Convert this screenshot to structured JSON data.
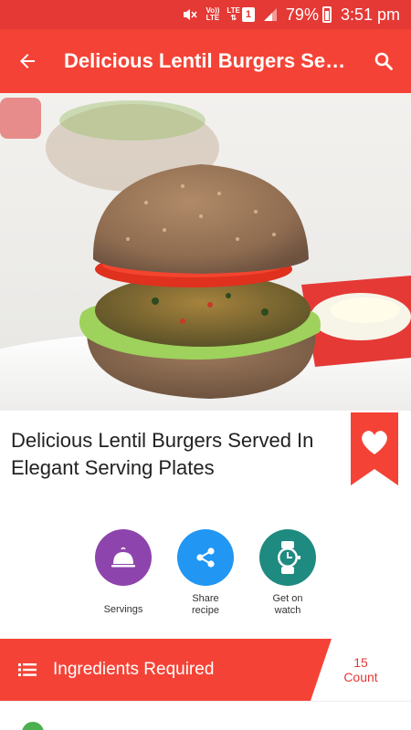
{
  "status_bar": {
    "network_label_top": "Vo))",
    "network_label_bottom": "LTE",
    "lte_label": "LTE",
    "sim_slot": "1",
    "battery": "79%",
    "time": "3:51 pm"
  },
  "app_bar": {
    "title": "Delicious Lentil Burgers Served In Elegant Serving Plates"
  },
  "recipe": {
    "title": "Delicious Lentil Burgers Served In Elegant Serving Plates"
  },
  "actions": [
    {
      "label": "Servings",
      "icon": "cloche-icon",
      "color": "#8e44ad"
    },
    {
      "label": "Share recipe",
      "icon": "share-icon",
      "color": "#2196f3"
    },
    {
      "label": "Get on watch",
      "icon": "watch-icon",
      "color": "#1f8a80"
    }
  ],
  "ingredients": {
    "label": "Ingredients Required",
    "count": "15",
    "count_label": "Count"
  },
  "colors": {
    "status_bar": "#e53935",
    "app_bar": "#f44336",
    "accent": "#f44336"
  }
}
